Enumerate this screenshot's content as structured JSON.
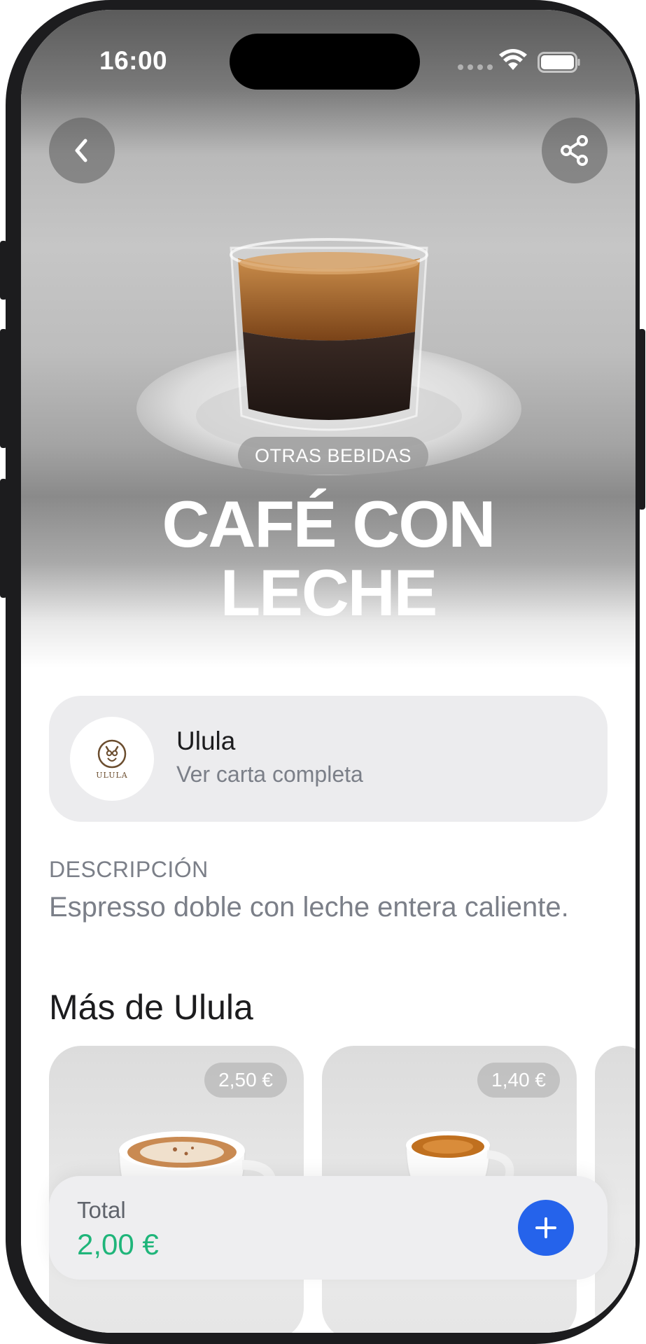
{
  "status_bar": {
    "time": "16:00"
  },
  "hero": {
    "category": "OTRAS BEBIDAS",
    "title_line1": "CAFÉ CON",
    "title_line2": "LECHE"
  },
  "restaurant": {
    "logo_text": "ULULA",
    "name": "Ulula",
    "link": "Ver carta completa"
  },
  "description": {
    "label": "DESCRIPCIÓN",
    "text": "Espresso doble con leche entera caliente."
  },
  "more": {
    "title": "Más de Ulula",
    "items": [
      {
        "price": "2,50 €",
        "image": "cappuccino"
      },
      {
        "price": "1,40 €",
        "image": "espresso"
      }
    ]
  },
  "footer": {
    "total_label": "Total",
    "total_value": "2,00 €"
  },
  "colors": {
    "accent_blue": "#2563eb",
    "price_green": "#1fb57a",
    "muted_text": "#7b7f88"
  },
  "icons": [
    "back-chevron-icon",
    "share-icon",
    "wifi-icon",
    "battery-icon",
    "plus-icon"
  ]
}
